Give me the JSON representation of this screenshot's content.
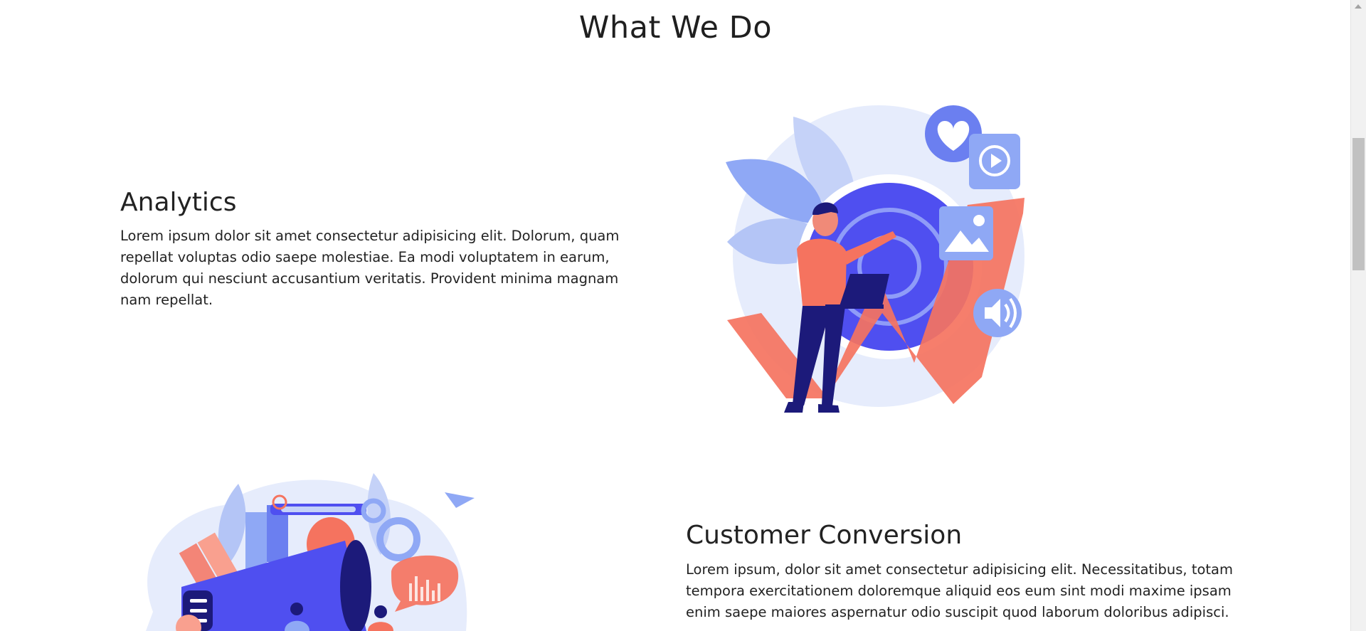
{
  "section": {
    "title": "What We Do"
  },
  "features": [
    {
      "heading": "Analytics",
      "text": "Lorem ipsum dolor sit amet consectetur adipisicing elit. Dolorum, quam repellat voluptas odio saepe molestiae. Ea modi voluptatem in earum, dolorum qui nesciunt accusantium veritatis. Provident minima magnam nam repellat.",
      "illustration_icon": "analytics-target-illustration"
    },
    {
      "heading": "Customer Conversion",
      "text": "Lorem ipsum, dolor sit amet consectetur adipisicing elit. Necessitatibus, totam tempora exercitationem doloremque aliquid eos eum sint modi maxime ipsam enim saepe maiores aspernatur odio suscipit quod laborum doloribus adipisci.",
      "illustration_icon": "marketing-megaphone-illustration"
    }
  ],
  "colors": {
    "accent_blue": "#4f4ff0",
    "light_blue": "#8fa8f5",
    "pale_blue": "#e6ecfc",
    "coral": "#f5735f",
    "navy": "#1c1a7a"
  }
}
